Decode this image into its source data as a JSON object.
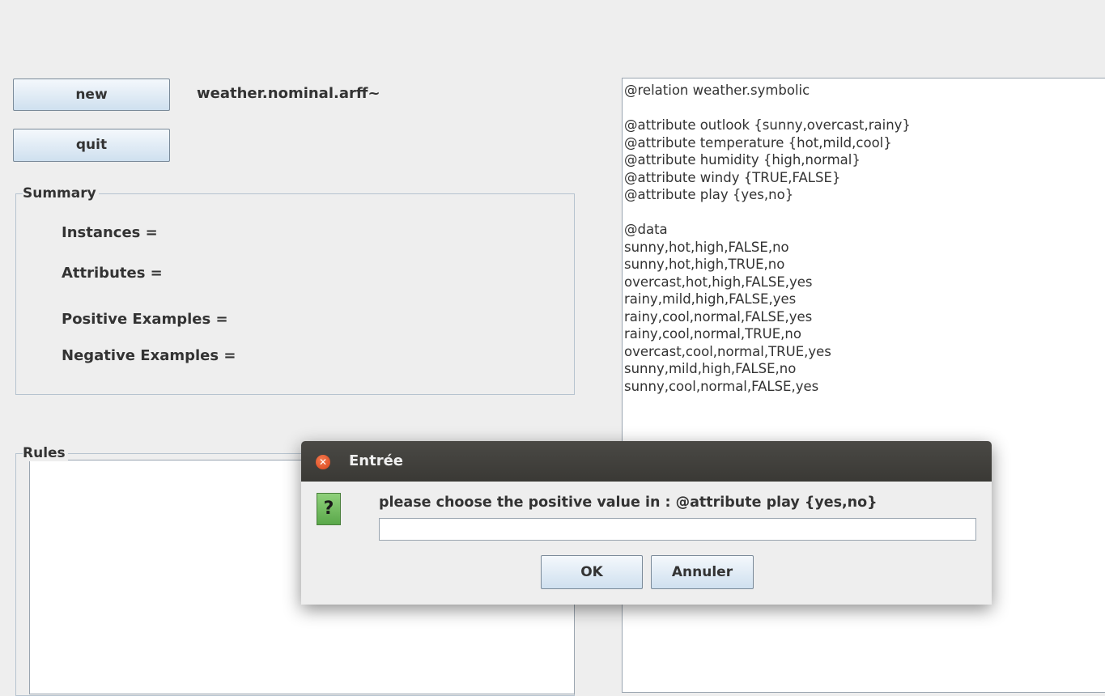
{
  "toolbar": {
    "new_label": "new",
    "quit_label": "quit",
    "filename": "weather.nominal.arff~"
  },
  "summary": {
    "title": "Summary",
    "instances_label": "Instances =",
    "attributes_label": "Attributes =",
    "positive_label": "Positive Examples  =",
    "negative_label": "Negative Examples ="
  },
  "rules": {
    "title": "Rules"
  },
  "data_text": {
    "lines": [
      "@relation weather.symbolic",
      "",
      "@attribute outlook {sunny,overcast,rainy}",
      "@attribute temperature {hot,mild,cool}",
      "@attribute humidity {high,normal}",
      "@attribute windy {TRUE,FALSE}",
      "@attribute play {yes,no}",
      "",
      "@data",
      "sunny,hot,high,FALSE,no",
      "sunny,hot,high,TRUE,no",
      "overcast,hot,high,FALSE,yes",
      "rainy,mild,high,FALSE,yes",
      "rainy,cool,normal,FALSE,yes",
      "rainy,cool,normal,TRUE,no",
      "overcast,cool,normal,TRUE,yes",
      "sunny,mild,high,FALSE,no",
      "sunny,cool,normal,FALSE,yes"
    ]
  },
  "dialog": {
    "title": "Entrée",
    "close_icon": "close-icon",
    "question_icon": "question-icon",
    "question_glyph": "?",
    "prompt": "please choose the positive value in : @attribute play {yes,no}",
    "input_value": "",
    "ok_label": "OK",
    "cancel_label": "Annuler"
  }
}
